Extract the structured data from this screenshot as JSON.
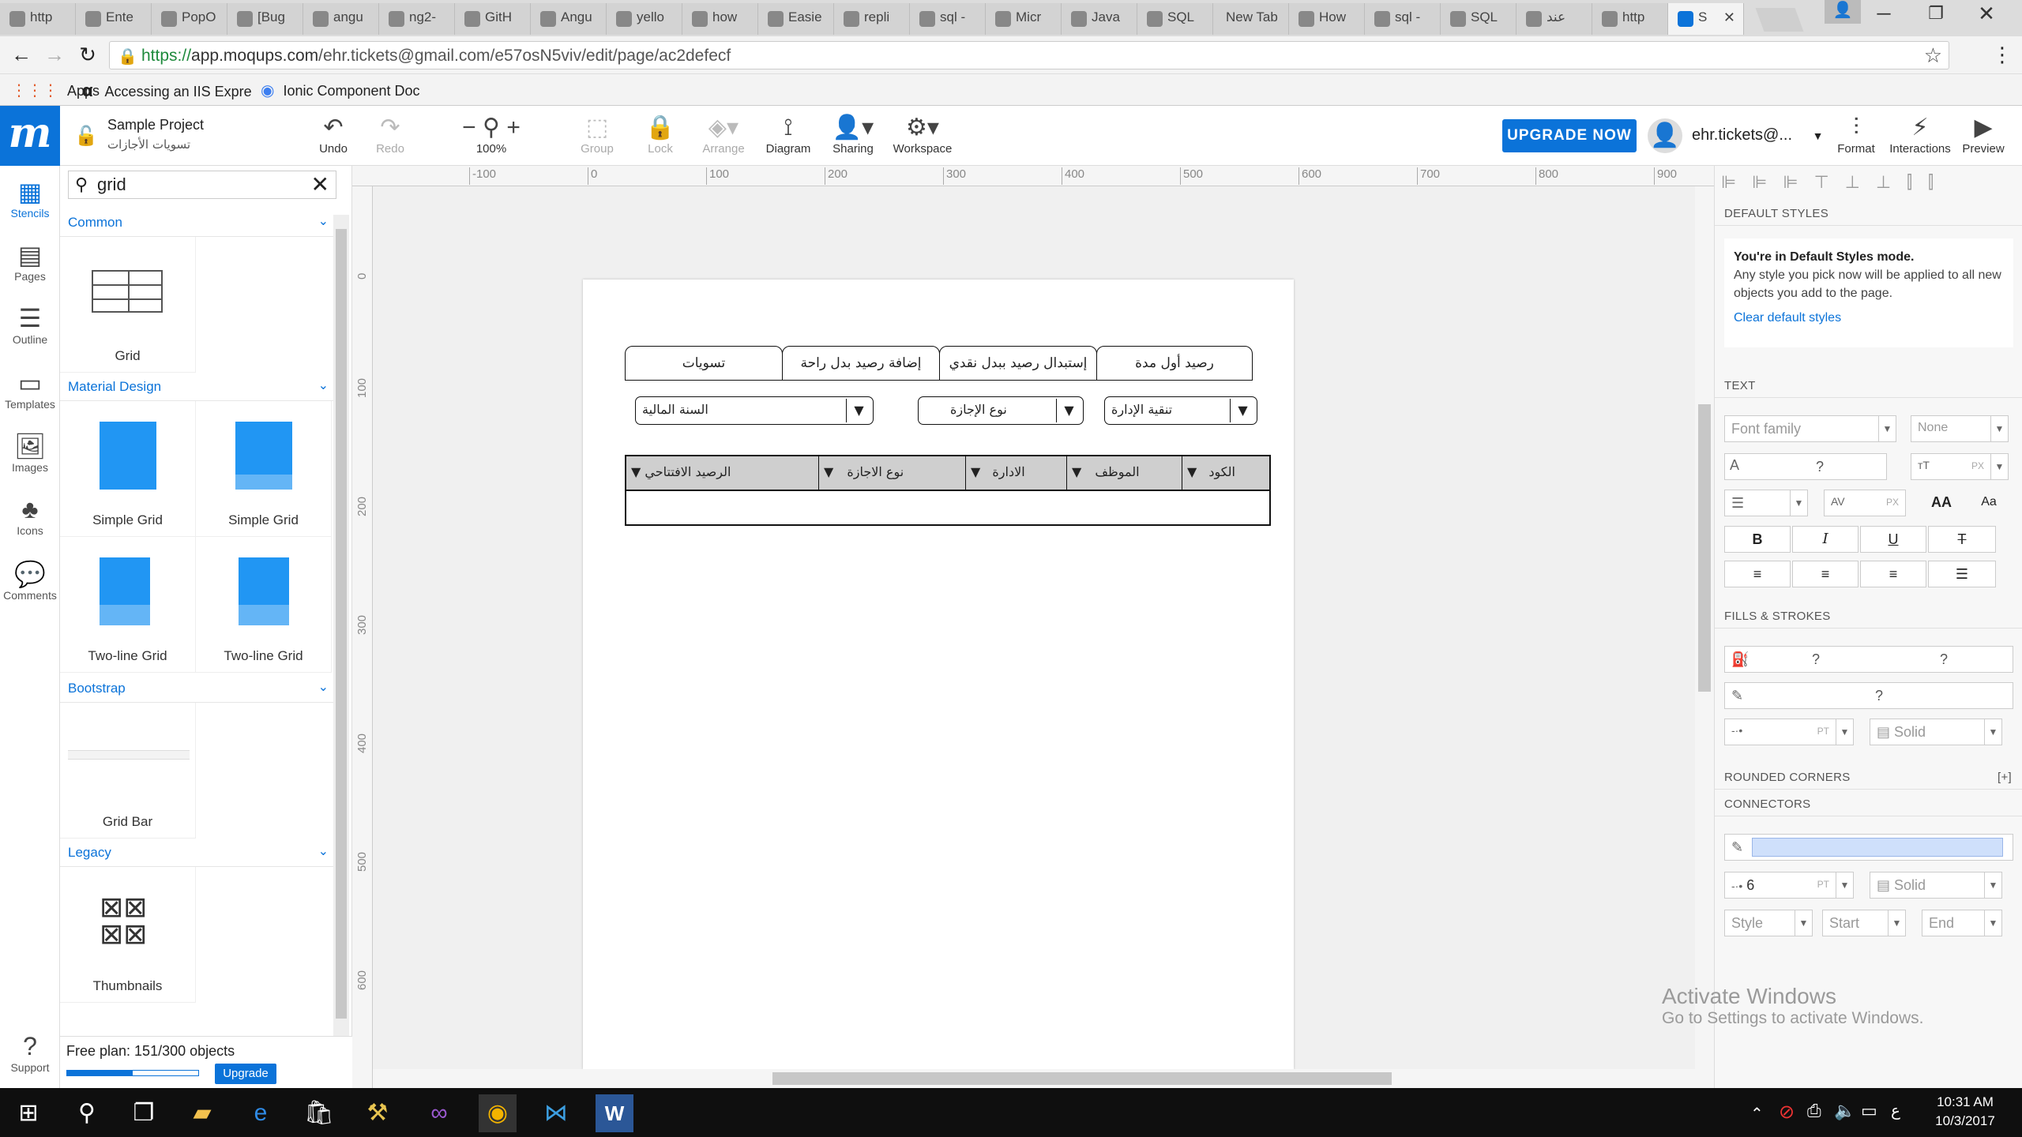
{
  "browser": {
    "tabs": [
      {
        "label": "http"
      },
      {
        "label": "Ente"
      },
      {
        "label": "PopO"
      },
      {
        "label": "[Bug"
      },
      {
        "label": "angu"
      },
      {
        "label": "ng2-"
      },
      {
        "label": "GitH"
      },
      {
        "label": "Angu"
      },
      {
        "label": "yello"
      },
      {
        "label": "how"
      },
      {
        "label": "Easie"
      },
      {
        "label": "repli"
      },
      {
        "label": "sql -"
      },
      {
        "label": "Micr"
      },
      {
        "label": "Java"
      },
      {
        "label": "SQL"
      },
      {
        "label": "New Tab"
      },
      {
        "label": "How"
      },
      {
        "label": "sql -"
      },
      {
        "label": "SQL"
      },
      {
        "label": "عند"
      },
      {
        "label": "http"
      },
      {
        "label": "S"
      }
    ],
    "url_scheme": "https://",
    "url_host": "app.moqups.com",
    "url_path": "/ehr.tickets@gmail.com/e57osN5viv/edit/page/ac2defecf",
    "bookmarks": [
      "Apps",
      "Accessing an IIS Expre",
      "Ionic Component Doc"
    ]
  },
  "toolbar": {
    "logo": "m",
    "project_name": "Sample Project",
    "page_name": "تسويات الأجازات",
    "undo": "Undo",
    "redo": "Redo",
    "zoom": "100%",
    "group": "Group",
    "lock": "Lock",
    "arrange": "Arrange",
    "diagram": "Diagram",
    "sharing": "Sharing",
    "workspace": "Workspace",
    "upgrade_now": "UPGRADE NOW",
    "user": "ehr.tickets@...",
    "format": "Format",
    "interactions": "Interactions",
    "preview": "Preview"
  },
  "rail": [
    "Stencils",
    "Pages",
    "Outline",
    "Templates",
    "Images",
    "Icons",
    "Comments",
    "Support"
  ],
  "stencils": {
    "search_value": "grid",
    "sections": {
      "common": "Common",
      "material": "Material Design",
      "bootstrap": "Bootstrap",
      "legacy": "Legacy"
    },
    "items": {
      "grid": "Grid",
      "simple_grid_1": "Simple Grid",
      "simple_grid_2": "Simple Grid",
      "two_line_1": "Two-line Grid",
      "two_line_2": "Two-line Grid",
      "grid_bar": "Grid Bar",
      "thumbnails": "Thumbnails"
    },
    "free_plan": "Free plan: 151/300 objects",
    "free_plan_progress": 0.503,
    "upgrade": "Upgrade"
  },
  "ruler": {
    "top": [
      "-100",
      "0",
      "100",
      "200",
      "300",
      "400",
      "500",
      "600",
      "700",
      "800",
      "900"
    ],
    "left": [
      "0",
      "100",
      "200",
      "300",
      "400",
      "500",
      "600"
    ]
  },
  "mockup": {
    "tabs": [
      "تسويات",
      "إضافة رصيد بدل راحة",
      "إستبدال رصيد ببدل نقدي",
      "رصيد أول مدة"
    ],
    "dropdowns": [
      "السنة المالية",
      "نوع الإجازة",
      "تنقية الإدارة"
    ],
    "grid_columns": [
      "الرصيد الافتتاحي",
      "نوع الاجازة",
      "الادارة",
      "الموظف",
      "الكود"
    ]
  },
  "props": {
    "default_styles": "DEFAULT STYLES",
    "default_mode_title": "You're in Default Styles mode.",
    "default_mode_text": "Any style you pick now will be applied to all new objects you add to the page.",
    "clear_default": "Clear default styles",
    "text": "TEXT",
    "font_family": "Font family",
    "font_none": "None",
    "unknown": "?",
    "px": "PX",
    "pt": "PT",
    "bold": "B",
    "italic": "I",
    "underline": "U",
    "strike": "T",
    "aa_upper": "AA",
    "aa_small": "Aa",
    "fills_strokes": "FILLS & STROKES",
    "solid": "Solid",
    "rounded_corners": "ROUNDED CORNERS",
    "plus": "[+]",
    "connectors": "CONNECTORS",
    "connector_width": "6",
    "style": "Style",
    "start": "Start",
    "end": "End"
  },
  "watermark": {
    "title": "Activate Windows",
    "subtitle": "Go to Settings to activate Windows."
  },
  "taskbar": {
    "time": "10:31 AM",
    "date": "10/3/2017",
    "lang": "ع"
  }
}
